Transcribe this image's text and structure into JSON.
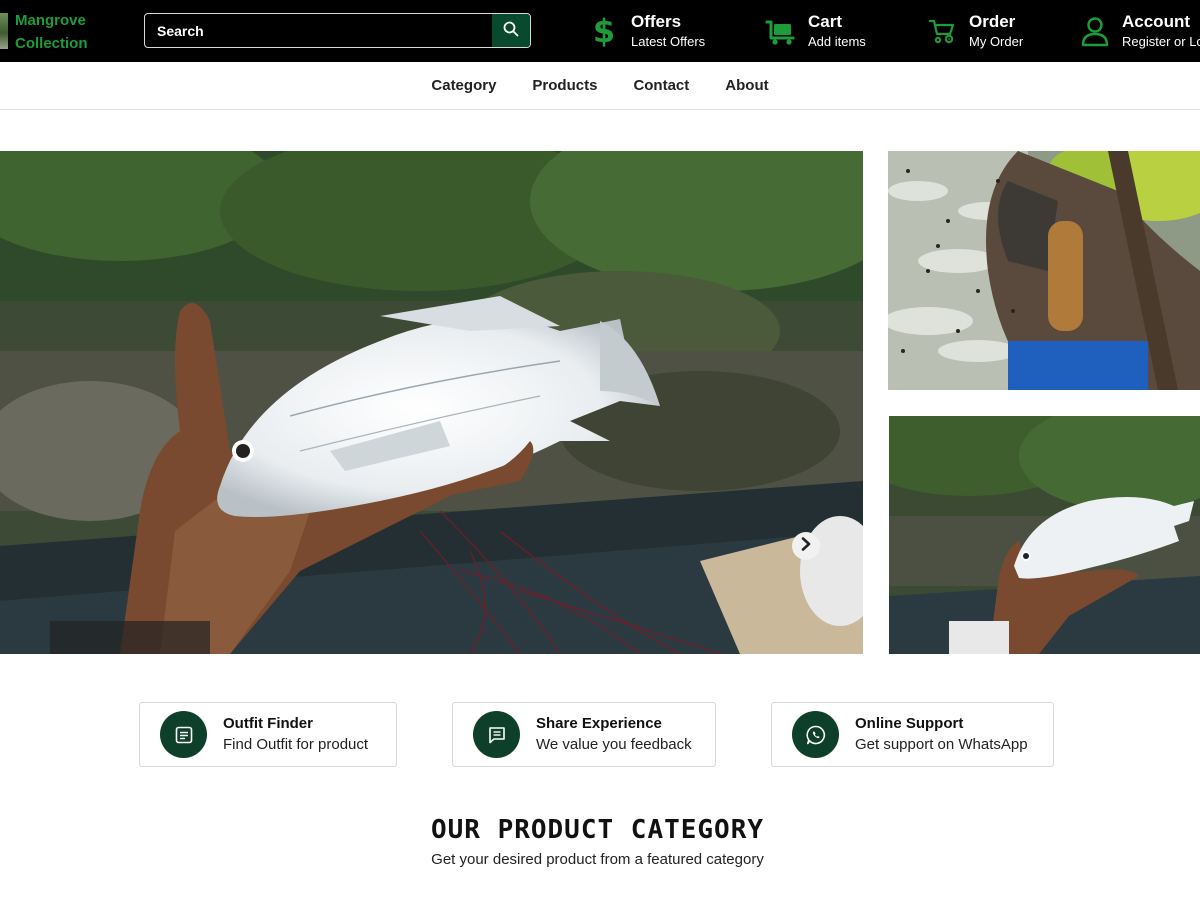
{
  "brand": {
    "line1": "Mangrove",
    "line2": "Collection",
    "color": "#1f9c3a"
  },
  "search": {
    "placeholder": "Search",
    "value": "",
    "icon": "search-icon"
  },
  "header_items": {
    "offers": {
      "title": "Offers",
      "subtitle": "Latest Offers",
      "icon": "dollar-icon"
    },
    "cart": {
      "title": "Cart",
      "subtitle": "Add items",
      "icon": "cart-icon"
    },
    "order": {
      "title": "Order",
      "subtitle": "My Order",
      "icon": "order-cart-icon"
    },
    "account": {
      "title": "Account",
      "subtitle": "Register or Login",
      "icon": "user-icon"
    }
  },
  "nav": [
    "Category",
    "Products",
    "Contact",
    "About"
  ],
  "carousel": {
    "slide_count": 5,
    "active_index": 1,
    "next_icon": "chevron-right-icon"
  },
  "features": [
    {
      "title": "Outfit Finder",
      "subtitle": "Find Outfit for product",
      "icon": "document-icon"
    },
    {
      "title": "Share Experience",
      "subtitle": "We value you feedback",
      "icon": "message-icon"
    },
    {
      "title": "Online Support",
      "subtitle": "Get support on WhatsApp",
      "icon": "whatsapp-icon"
    }
  ],
  "section": {
    "title": "OUR PRODUCT CATEGORY",
    "subtitle": "Get your desired product from a featured category"
  },
  "colors": {
    "header_bg": "#000000",
    "accent_green": "#1f9c3a",
    "dark_green": "#0d3f2a"
  }
}
